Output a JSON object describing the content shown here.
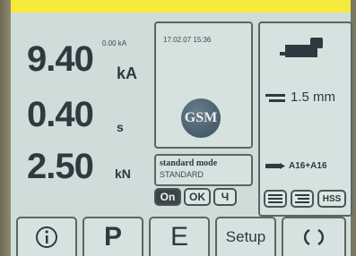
{
  "readouts": {
    "current_value": "9.40",
    "current_unit": "kA",
    "current_ref": "0.00 kA",
    "time_value": "0.40",
    "time_unit": "s",
    "force_value": "2.50",
    "force_unit": "kN"
  },
  "info": {
    "datetime": "17.02.07  15:36",
    "logo_text": "GSM"
  },
  "mode": {
    "title": "standard mode",
    "subtitle": "STANDARD"
  },
  "controls": {
    "on_label": "On",
    "ok_label": "OK",
    "pulse_label": "Ч"
  },
  "right": {
    "thickness": "1.5 mm",
    "material": "A16+A16",
    "hss_label": "HSS"
  },
  "bottom_nav": {
    "p_label": "P",
    "e_label": "E",
    "setup_label": "Setup"
  },
  "colors": {
    "screen_bg": "#cfdcd9",
    "accent_yellow": "#f6ea3c",
    "text_dark": "#2e3940"
  }
}
